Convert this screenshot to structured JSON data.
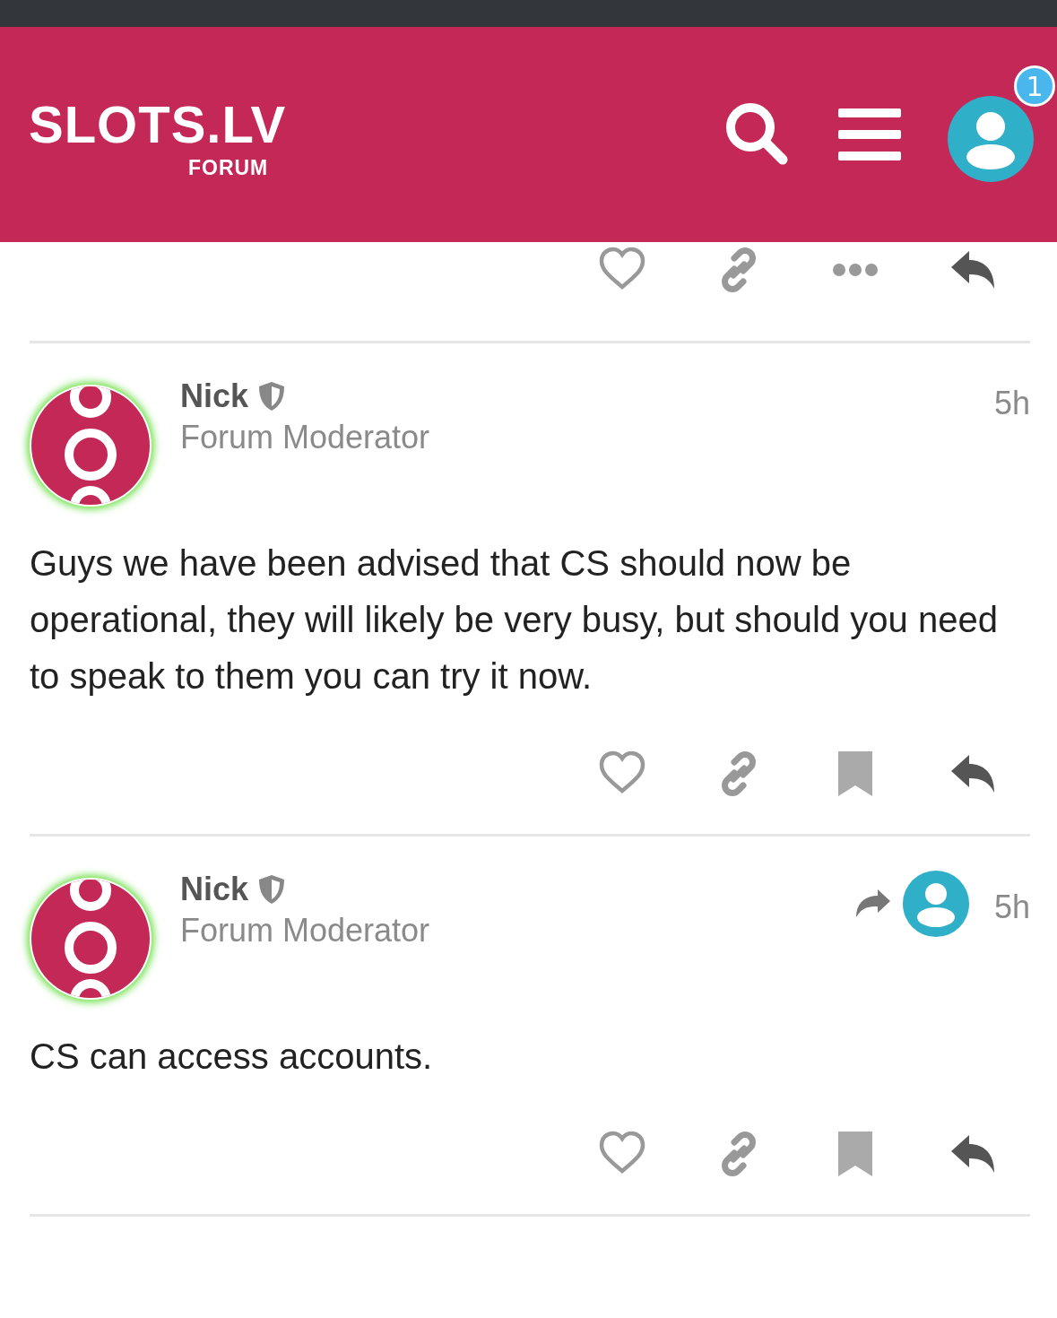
{
  "header": {
    "logo": "SLOTS.LV",
    "logo_subtitle": "FORUM",
    "notification_count": "1"
  },
  "posts": [
    {
      "partial": true,
      "actions": [
        {
          "kind": "like"
        },
        {
          "kind": "link"
        },
        {
          "kind": "more"
        },
        {
          "kind": "reply"
        }
      ]
    },
    {
      "author": "Nick",
      "moderator": true,
      "title": "Forum Moderator",
      "online": true,
      "time": "5h",
      "reply_to": false,
      "body": "Guys we have been advised that CS should now be operational, they will likely be very busy, but should you need to speak to them you can try it now.",
      "actions": [
        {
          "kind": "like"
        },
        {
          "kind": "link"
        },
        {
          "kind": "bookmark"
        },
        {
          "kind": "reply"
        }
      ]
    },
    {
      "author": "Nick",
      "moderator": true,
      "title": "Forum Moderator",
      "online": true,
      "time": "5h",
      "reply_to": true,
      "body": "CS can access accounts.",
      "actions": [
        {
          "kind": "like"
        },
        {
          "kind": "link"
        },
        {
          "kind": "bookmark"
        },
        {
          "kind": "reply"
        }
      ]
    }
  ]
}
